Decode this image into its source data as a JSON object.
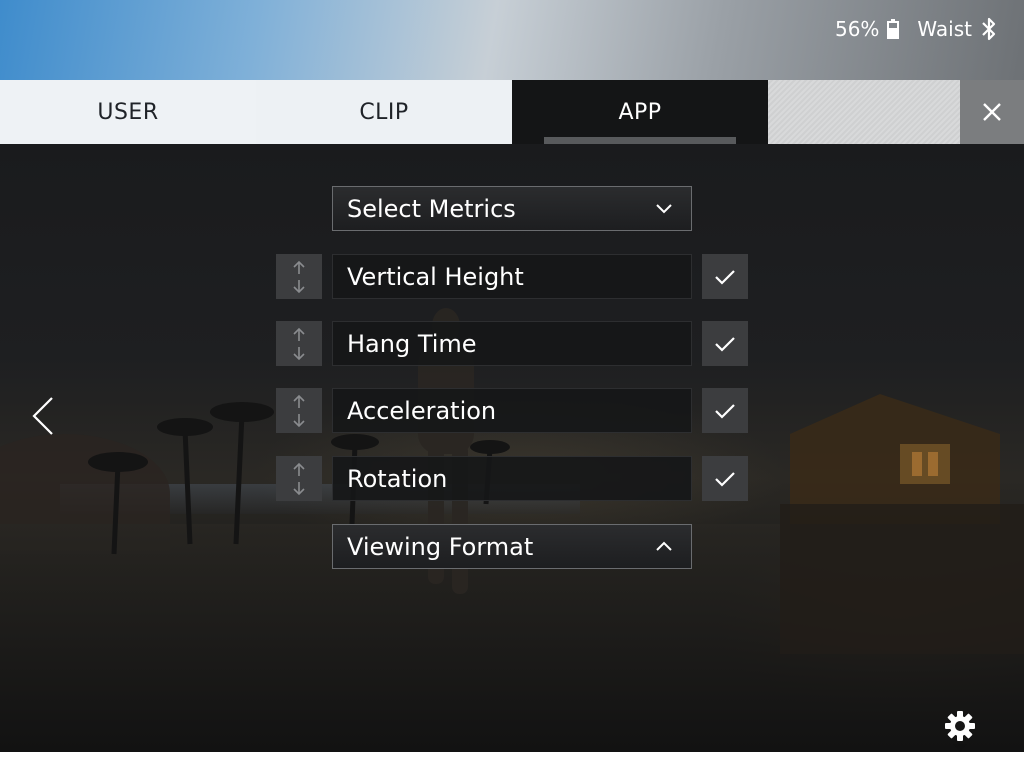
{
  "status": {
    "battery_percent": "56%",
    "battery_level": 0.56,
    "sensor_location": "Waist",
    "bluetooth_icon": "bluetooth-icon"
  },
  "tabs": [
    {
      "label": "USER",
      "active": false
    },
    {
      "label": "CLIP",
      "active": false
    },
    {
      "label": "APP",
      "active": true
    }
  ],
  "close_icon": "close-icon",
  "select_metrics": {
    "label": "Select Metrics",
    "icon": "chevron-down-icon"
  },
  "metrics": [
    {
      "label": "Vertical Height",
      "checked": true
    },
    {
      "label": "Hang Time",
      "checked": true
    },
    {
      "label": "Acceleration",
      "checked": true
    },
    {
      "label": "Rotation",
      "checked": true
    }
  ],
  "viewing_format": {
    "label": "Viewing Format",
    "icon": "chevron-up-icon"
  },
  "nav": {
    "back_icon": "chevron-left-icon"
  },
  "settings_icon": "gear-icon",
  "colors": {
    "active_tab_bg": "#141516",
    "inactive_tab_bg": "#eef2f5",
    "close_bg": "#7b7d7f",
    "control_bg": "#3c3d3f"
  }
}
